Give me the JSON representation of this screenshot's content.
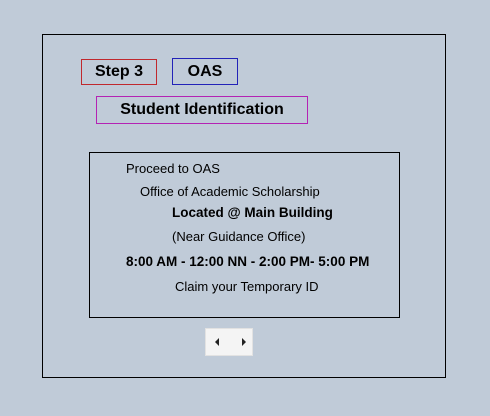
{
  "header": {
    "step_label": "Step 3",
    "office_label": "OAS",
    "section_label": "Student Identification"
  },
  "info": {
    "line1": "Proceed to OAS",
    "line2": "Office of Academic Scholarship",
    "line3": "Located @ Main Building",
    "line4": "(Near Guidance Office)",
    "line5": "8:00 AM - 12:00 NN - 2:00 PM- 5:00 PM",
    "line6": "Claim your Temporary ID"
  },
  "navigation": {
    "prev_icon": "arrow-left-icon",
    "next_icon": "arrow-right-icon"
  },
  "colors": {
    "background": "#c0cbd8",
    "step_border": "#c0282d",
    "oas_border": "#2222b8",
    "student_border": "#b422b4"
  }
}
